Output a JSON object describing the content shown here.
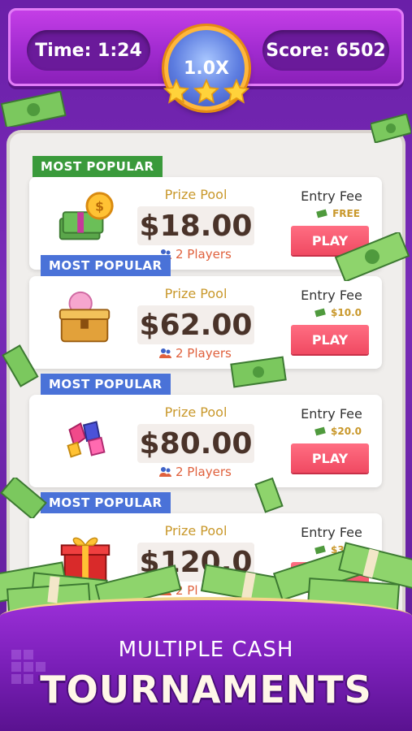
{
  "header": {
    "time": "Time: 1:24",
    "score": "Score: 6502",
    "multiplier": "1.0X",
    "stars": 3
  },
  "cards": [
    {
      "badge": "MOST POPULAR",
      "badge_color": "#3a9a3b",
      "icon": "cash-stack-coin-icon",
      "prize_label": "Prize Pool",
      "prize": "$18.00",
      "players": "2 Players",
      "fee_label": "Entry Fee",
      "fee": "FREE",
      "play": "PLAY"
    },
    {
      "badge": "MOST POPULAR",
      "badge_color": "#4a72d8",
      "icon": "treasure-chest-icon",
      "prize_label": "Prize Pool",
      "prize": "$62.00",
      "players": "2 Players",
      "fee_label": "Entry Fee",
      "fee": "$10.0",
      "play": "PLAY"
    },
    {
      "badge": "MOST POPULAR",
      "badge_color": "#4a72d8",
      "icon": "gems-icon",
      "prize_label": "Prize Pool",
      "prize": "$80.00",
      "players": "2 Players",
      "fee_label": "Entry Fee",
      "fee": "$20.0",
      "play": "PLAY"
    },
    {
      "badge": "MOST POPULAR",
      "badge_color": "#4a72d8",
      "icon": "gift-box-icon",
      "prize_label": "Prize Pool",
      "prize": "$120.0",
      "players": "2 Pl",
      "fee_label": "Entry Fee",
      "fee": "$30.0",
      "play": "PLAY"
    }
  ],
  "banner": {
    "subtitle": "MULTIPLE CASH",
    "title": "TOURNAMENTS"
  },
  "colors": {
    "accent_purple": "#a12bd0",
    "play_button": "#f04a62",
    "prize_gold": "#c9982b",
    "players_orange": "#e0613d"
  }
}
